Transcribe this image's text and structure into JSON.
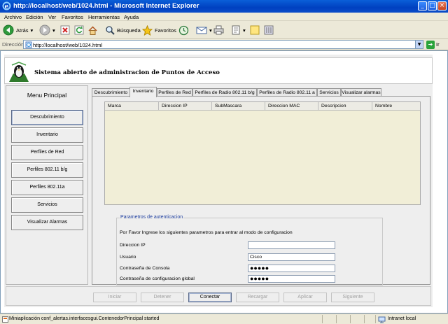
{
  "window": {
    "title": "http://localhost/web/1024.html - Microsoft Internet Explorer"
  },
  "menubar": [
    "Archivo",
    "Edición",
    "Ver",
    "Favoritos",
    "Herramientas",
    "Ayuda"
  ],
  "toolbar": {
    "back_label": "Atrás",
    "search_label": "Búsqueda",
    "favorites_label": "Favoritos"
  },
  "address": {
    "label": "Dirección",
    "url": "http://localhost/web/1024.html",
    "go_label": "Ir"
  },
  "app": {
    "title": "Sistema abierto de administracion de Puntos de Acceso",
    "menu_title": "Menu Principal",
    "menu_items": [
      "Descubrimiento",
      "Inventario",
      "Perfiles de Red",
      "Perfiles 802.11 b/g",
      "Perfiles 802.11a",
      "Servicios",
      "Visualizar Alarmas"
    ],
    "tabs": [
      "Descubrimiento",
      "Inventario",
      "Perfiles de Red",
      "Perfiles de Radio 802.11 b/g",
      "Perfiles de Radio 802.11 a",
      "Servicios",
      "Visualizar alarmas"
    ],
    "active_tab": "Inventario",
    "table_columns": [
      "Marca",
      "Direccion IP",
      "SubMascara",
      "Direccion MAC",
      "Descripcion",
      "Nombre"
    ],
    "auth": {
      "legend": "Parametros de autenticacion",
      "instructions": "Por Favor Ingrese los siguientes parametros para entrar al modo de configuracion",
      "ip_label": "Direccion IP",
      "ip_value": "",
      "user_label": "Usuario",
      "user_value": "Cisco",
      "console_pw_label": "Contraseña de Consola",
      "console_pw_value": "●●●●●",
      "global_pw_label": "Contraseña de configuracion global",
      "global_pw_value": "●●●●●"
    },
    "actions": [
      "Iniciar",
      "Detener",
      "Conectar",
      "Recargar",
      "Aplicar",
      "Siguiente"
    ],
    "enabled_action": "Conectar"
  },
  "statusbar": {
    "text": "Miniaplicación conf_alertas.interfacesgui.ContenedorPrincipal started",
    "zone": "Intranet local"
  },
  "colors": {
    "titlebar": "#0a5fd8",
    "legend_text": "#1f3f9f",
    "table_bg": "#f1eed7"
  }
}
